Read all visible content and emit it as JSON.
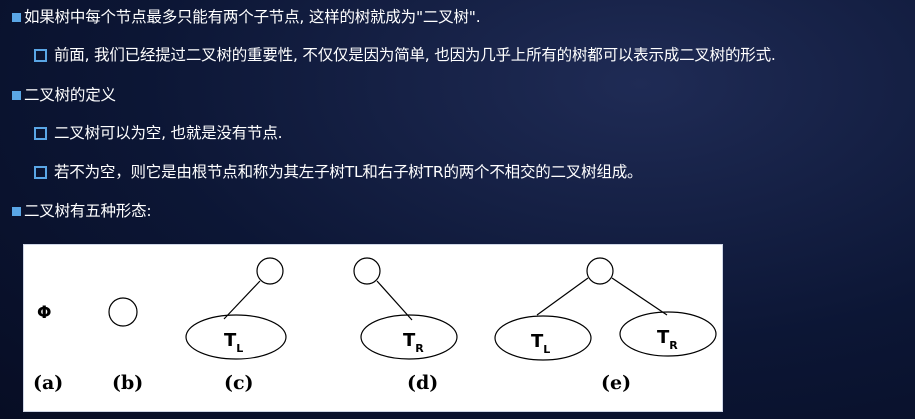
{
  "bullets": [
    {
      "level": 1,
      "text": "如果树中每个节点最多只能有两个子节点, 这样的树就成为\"二叉树\"."
    },
    {
      "level": 2,
      "text": "前面, 我们已经提过二叉树的重要性, 不仅仅是因为简单, 也因为几乎上所有的树都可以表示成二叉树的形式."
    },
    {
      "level": 1,
      "text": "二叉树的定义"
    },
    {
      "level": 2,
      "text": "二叉树可以为空, 也就是没有节点."
    },
    {
      "level": 2,
      "text": "若不为空，则它是由根节点和称为其左子树TL和右子树TR的两个不相交的二叉树组成。"
    },
    {
      "level": 1,
      "text": "二叉树有五种形态:"
    }
  ],
  "figure": {
    "empty_symbol": "Φ",
    "subtree_left": {
      "main": "T",
      "sub": "L"
    },
    "subtree_right": {
      "main": "T",
      "sub": "R"
    },
    "labels": [
      "(a)",
      "(b)",
      "(c)",
      "(d)",
      "(e)"
    ]
  },
  "colors": {
    "accent": "#5aa6e6",
    "background": "#0c1635"
  }
}
